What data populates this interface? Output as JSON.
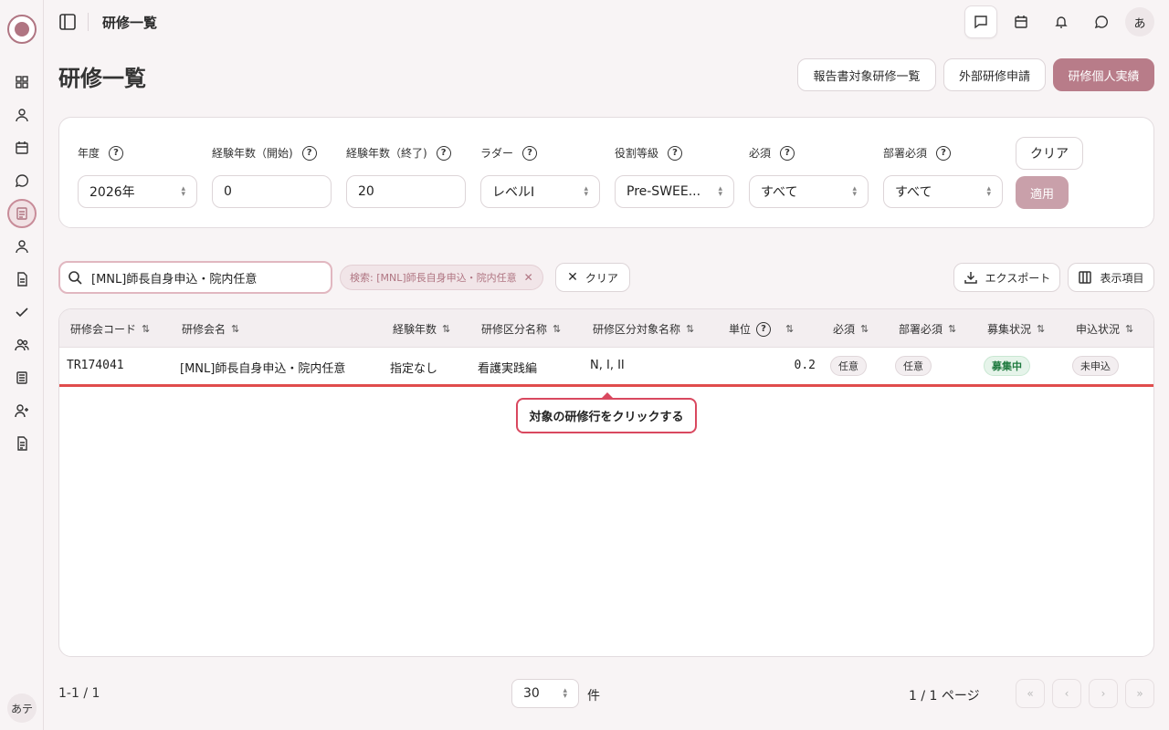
{
  "sidebar": {
    "items": [
      "grid-icon",
      "user-icon",
      "calendar-icon",
      "chat-icon",
      "document-icon",
      "user-icon",
      "file-icon",
      "check-icon",
      "users-icon",
      "list-icon",
      "user-plus-icon",
      "file-text-icon"
    ],
    "active": "document-icon",
    "bottom_avatar": "あテ"
  },
  "topbar": {
    "breadcrumb": "研修一覧",
    "user_avatar": "あ"
  },
  "header": {
    "title": "研修一覧",
    "btn_report_list": "報告書対象研修一覧",
    "btn_external": "外部研修申請",
    "btn_personal": "研修個人実績"
  },
  "filters": {
    "year_label": "年度",
    "year_value": "2026年",
    "exp_start_label": "経験年数（開始)",
    "exp_start_value": "0",
    "exp_end_label": "経験年数（終了)",
    "exp_end_value": "20",
    "ladder_label": "ラダー",
    "ladder_value": "レベルI",
    "role_label": "役割等級",
    "role_value": "Pre-SWEE...",
    "required_label": "必須",
    "required_value": "すべて",
    "dept_required_label": "部署必須",
    "dept_required_value": "すべて",
    "clear_label": "クリア",
    "apply_label": "適用"
  },
  "search": {
    "value": "[MNL]師長自身申込・院内任意",
    "chip": "検索: [MNL]師長自身申込・院内任意",
    "clear_label": "クリア",
    "export_label": "エクスポート",
    "columns_label": "表示項目"
  },
  "table": {
    "headers": {
      "code": "研修会コード",
      "name": "研修会名",
      "experience": "経験年数",
      "category": "研修区分名称",
      "category_target": "研修区分対象名称",
      "units": "単位",
      "required": "必須",
      "dept_required": "部署必須",
      "recruit": "募集状況",
      "apply": "申込状況"
    },
    "rows": [
      {
        "code": "TR174041",
        "name": "[MNL]師長自身申込・院内任意",
        "experience": "指定なし",
        "category": "看護実践編",
        "category_target": "N, I, II",
        "units": "0.2",
        "required": "任意",
        "dept_required": "任意",
        "recruit": "募集中",
        "apply": "未申込"
      }
    ]
  },
  "tooltip": "対象の研修行をクリックする",
  "footer": {
    "range": "1-1 / 1",
    "per_page": "30",
    "per_page_unit": "件",
    "page_info": "1 / 1 ページ"
  },
  "colors": {
    "accent": "#b87c89",
    "highlight_red": "#e04c4c",
    "recruit_green": "#1f7a3f"
  }
}
